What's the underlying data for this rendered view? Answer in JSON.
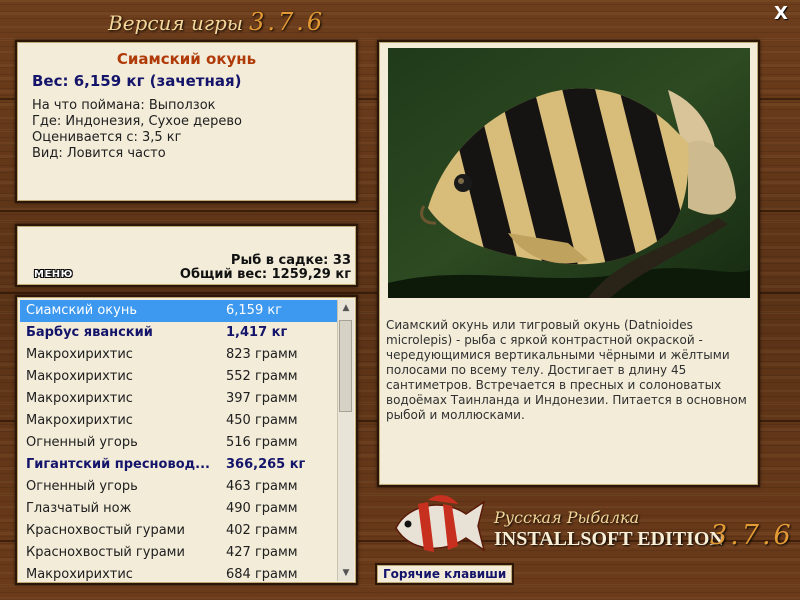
{
  "app": {
    "title_prefix": "Версия игры",
    "version": "3.7.6",
    "close_label": "X"
  },
  "fish": {
    "name": "Сиамский окунь",
    "weight_line": "Вес: 6,159 кг (зачетная)",
    "details": [
      "На что поймана: Выползок",
      "Где: Индонезия, Сухое дерево",
      "Оценивается с: 3,5 кг",
      "Вид: Ловится часто"
    ],
    "description": "Сиамский окунь или тигровый окунь (Datnioides microlepis) - рыба с яркой контрастной окраской - чередующимися вертикальными чёрными и жёлтыми полосами по всему телу. Достигает в длину 45 сантиметров. Встречается в пресных и солоноватых водоёмах Таинланда и Индонезии. Питается в основном рыбой и моллюсками."
  },
  "stats": {
    "fish_count": "Рыб в садке: 33",
    "total_weight": "Общий вес: 1259,29 кг",
    "menu_label": "МЕНЮ"
  },
  "fish_list": [
    {
      "name": "Сиамский окунь",
      "weight": "6,159 кг",
      "trophy": true,
      "selected": true
    },
    {
      "name": "Барбус яванский",
      "weight": "1,417 кг",
      "trophy": true,
      "selected": false
    },
    {
      "name": "Макрохирихтис",
      "weight": "823 грамм",
      "trophy": false,
      "selected": false
    },
    {
      "name": "Макрохирихтис",
      "weight": "552 грамм",
      "trophy": false,
      "selected": false
    },
    {
      "name": "Макрохирихтис",
      "weight": "397 грамм",
      "trophy": false,
      "selected": false
    },
    {
      "name": "Макрохирихтис",
      "weight": "450 грамм",
      "trophy": false,
      "selected": false
    },
    {
      "name": "Огненный угорь",
      "weight": "516 грамм",
      "trophy": false,
      "selected": false
    },
    {
      "name": "Гигантский пресновод...",
      "weight": "366,265 кг",
      "trophy": true,
      "selected": false
    },
    {
      "name": "Огненный угорь",
      "weight": "463 грамм",
      "trophy": false,
      "selected": false
    },
    {
      "name": "Глазчатый нож",
      "weight": "490 грамм",
      "trophy": false,
      "selected": false
    },
    {
      "name": "Краснохвостый гурами",
      "weight": "402 грамм",
      "trophy": false,
      "selected": false
    },
    {
      "name": "Краснохвостый гурами",
      "weight": "427 грамм",
      "trophy": false,
      "selected": false
    },
    {
      "name": "Макрохирихтис",
      "weight": "684 грамм",
      "trophy": false,
      "selected": false
    }
  ],
  "logo": {
    "line1": "Русская Рыбалка",
    "line2": "INSTALLSOFT EDITION",
    "version": "3.7.6"
  },
  "hotkeys_label": "Горячие клавиши",
  "colors": {
    "selected_row": "#3d98f0",
    "trophy_text": "#14146a",
    "fish_name": "#b03a08",
    "version_accent": "#e39a34"
  }
}
